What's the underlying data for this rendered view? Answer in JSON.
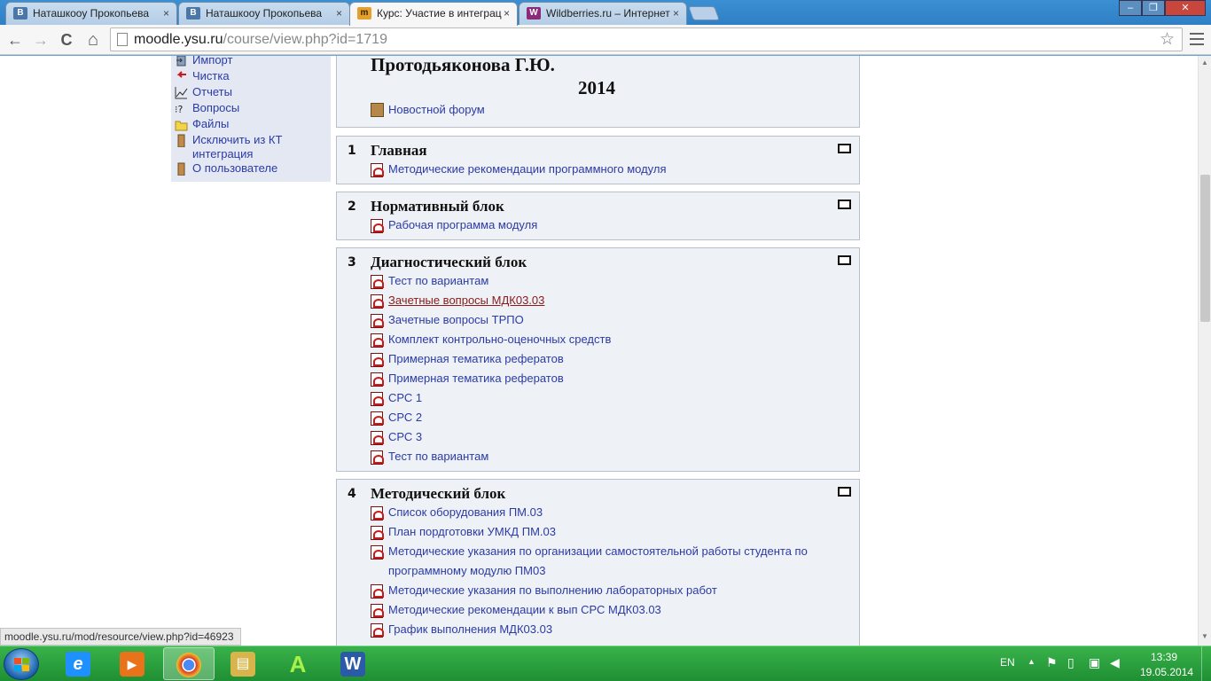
{
  "browser": {
    "tabs": [
      {
        "label": "Наташкооу Прокопьева",
        "icon": "vk-icon",
        "color": "#4a76a8",
        "glyph": "В"
      },
      {
        "label": "Наташкооу Прокопьева",
        "icon": "vk-icon",
        "color": "#4a76a8",
        "glyph": "В"
      },
      {
        "label": "Курс: Участие в интеграц",
        "icon": "moodle-icon",
        "color": "#d08a1a",
        "glyph": "m"
      },
      {
        "label": "Wildberries.ru – Интернет",
        "icon": "wildberries-icon",
        "color": "#8b2a7a",
        "glyph": "W"
      }
    ],
    "close_glyph": "×",
    "url_host": "moodle.ysu.ru",
    "url_path": "/course/view.php?id=1719",
    "back_glyph": "←",
    "forward_glyph": "→",
    "reload_glyph": "C",
    "home_glyph": "⌂",
    "star_glyph": "☆",
    "status_url": "moodle.ysu.ru/mod/resource/view.php?id=46923"
  },
  "sidebar": {
    "items": [
      {
        "label": "Импорт",
        "icon": "import-icon"
      },
      {
        "label": "Чистка",
        "icon": "reset-icon"
      },
      {
        "label": "Отчеты",
        "icon": "reports-icon"
      },
      {
        "label": "Вопросы",
        "icon": "questions-icon"
      },
      {
        "label": "Файлы",
        "icon": "folder-icon"
      },
      {
        "label": "Исключить из КТ",
        "icon": "unenrol-icon"
      },
      {
        "label": "интеграция",
        "icon": ""
      },
      {
        "label": "О пользователе",
        "icon": "profile-icon"
      }
    ]
  },
  "course": {
    "teacher": "Протодьяконова Г.Ю.",
    "year": "2014",
    "forum": "Новостной форум",
    "sections": [
      {
        "num": "1",
        "title": "Главная",
        "resources": [
          "Методические рекомендации программного модуля"
        ]
      },
      {
        "num": "2",
        "title": "Нормативный блок",
        "resources": [
          "Рабочая программа модуля"
        ]
      },
      {
        "num": "3",
        "title": "Диагностический блок",
        "resources": [
          "Тест по вариантам",
          "Зачетные вопросы МДК03.03",
          "Зачетные вопросы ТРПО",
          "Комплект контрольно-оценочных средств",
          "Примерная тематика рефератов",
          "Примерная тематика рефератов",
          "СРС 1",
          "СРС 2",
          "СРС 3",
          "Тест по вариантам"
        ]
      },
      {
        "num": "4",
        "title": "Методический блок",
        "resources": [
          "Список оборудования ПМ.03",
          "План пордготовки УМКД ПМ.03",
          "Методические указания по организации самостоятельной работы студента по",
          "программному модулю ПМ03",
          "Методические указания по выполнению лабораторных работ",
          "Методические рекомендации к вып СРС МДК03.03",
          "График выполнения МДК03.03"
        ]
      }
    ]
  },
  "taskbar": {
    "apps": [
      {
        "name": "internet-explorer",
        "glyph": "e",
        "color": "#1e90ff"
      },
      {
        "name": "media-player",
        "glyph": "▶",
        "color": "#e8731a"
      },
      {
        "name": "chrome",
        "glyph": "●",
        "color": "#d23b2a"
      },
      {
        "name": "file-explorer",
        "glyph": "▤",
        "color": "#d9b44a"
      },
      {
        "name": "app-a",
        "glyph": "A",
        "color": "#2fae2f"
      },
      {
        "name": "word",
        "glyph": "W",
        "color": "#2a5aa8"
      }
    ],
    "language": "EN",
    "time": "13:39",
    "date": "19.05.2014"
  }
}
